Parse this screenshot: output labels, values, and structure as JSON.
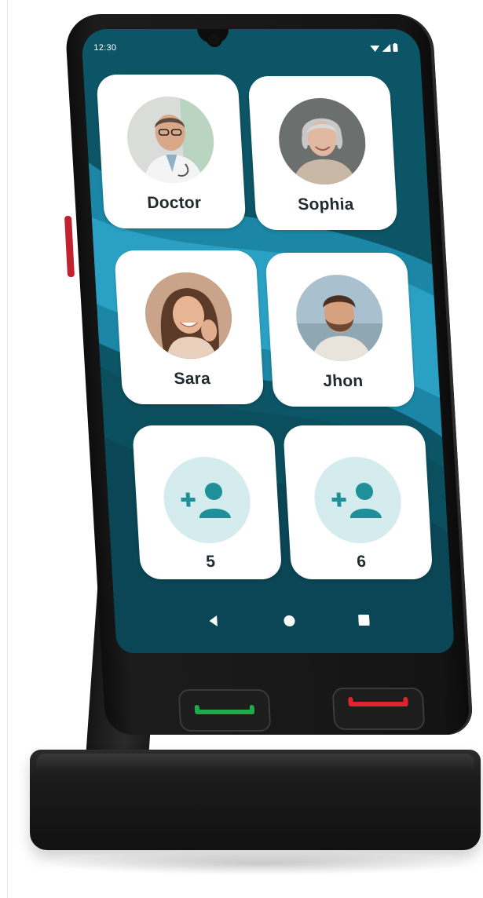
{
  "status_bar": {
    "time": "12:30",
    "icons": [
      "wifi-icon",
      "signal-icon",
      "battery-icon"
    ]
  },
  "contacts": [
    {
      "name": "Doctor",
      "avatar": "doctor-photo"
    },
    {
      "name": "Sophia",
      "avatar": "senior-woman-photo"
    },
    {
      "name": "Sara",
      "avatar": "young-woman-photo"
    },
    {
      "name": "Jhon",
      "avatar": "bearded-man-photo"
    }
  ],
  "empty_slots": [
    {
      "number": "5",
      "icon": "add-contact-icon"
    },
    {
      "number": "6",
      "icon": "add-contact-icon"
    }
  ],
  "nav_bar": {
    "buttons": [
      "back-icon",
      "home-icon",
      "recents-icon"
    ]
  },
  "hardware_keys": {
    "call": {
      "icon": "call-accept-icon",
      "color": "#1faa4b"
    },
    "end_call": {
      "icon": "call-end-icon",
      "color": "#e0232e"
    }
  },
  "colors": {
    "wallpaper_dark": "#0a4a5a",
    "wallpaper_light": "#2aa1c4",
    "tile": "#ffffff",
    "add_circle": "#d4ecee",
    "add_icon": "#1f8f9a"
  }
}
